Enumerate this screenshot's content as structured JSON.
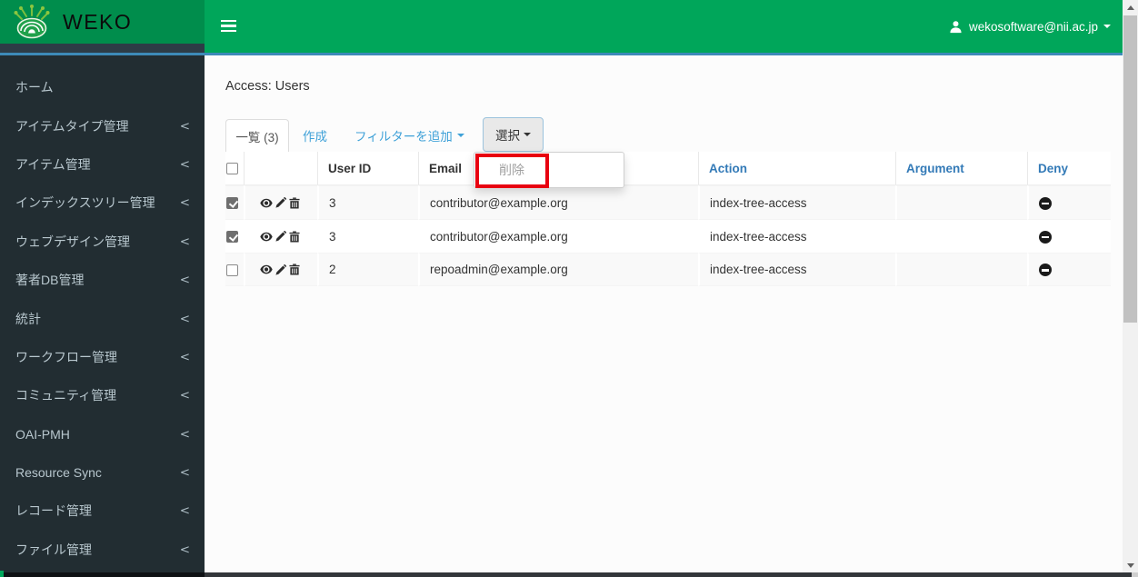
{
  "header": {
    "brand": "WEKO",
    "user_email": "wekosoftware@nii.ac.jp"
  },
  "sidebar": {
    "items": [
      {
        "label": "ホーム",
        "chevron": false
      },
      {
        "label": "アイテムタイプ管理",
        "chevron": true
      },
      {
        "label": "アイテム管理",
        "chevron": true
      },
      {
        "label": "インデックスツリー管理",
        "chevron": true
      },
      {
        "label": "ウェブデザイン管理",
        "chevron": true
      },
      {
        "label": "著者DB管理",
        "chevron": true
      },
      {
        "label": "統計",
        "chevron": true
      },
      {
        "label": "ワークフロー管理",
        "chevron": true
      },
      {
        "label": "コミュニティ管理",
        "chevron": true
      },
      {
        "label": "OAI-PMH",
        "chevron": true
      },
      {
        "label": "Resource Sync",
        "chevron": true
      },
      {
        "label": "レコード管理",
        "chevron": true
      },
      {
        "label": "ファイル管理",
        "chevron": true
      }
    ]
  },
  "main": {
    "title": "Access: Users",
    "tabs": {
      "list": "一覧 (3)",
      "create": "作成",
      "filter": "フィルターを追加",
      "select": "選択"
    },
    "dropdown": {
      "delete": "削除"
    },
    "table": {
      "headers": {
        "user_id": "User ID",
        "email": "Email",
        "action": "Action",
        "argument": "Argument",
        "deny": "Deny"
      },
      "rows": [
        {
          "checked": true,
          "user_id": "3",
          "email": "contributor@example.org",
          "action": "index-tree-access",
          "argument": ""
        },
        {
          "checked": true,
          "user_id": "3",
          "email": "contributor@example.org",
          "action": "index-tree-access",
          "argument": ""
        },
        {
          "checked": false,
          "user_id": "2",
          "email": "repoadmin@example.org",
          "action": "index-tree-access",
          "argument": ""
        }
      ]
    }
  },
  "annotation": {
    "color": "#e80010"
  }
}
